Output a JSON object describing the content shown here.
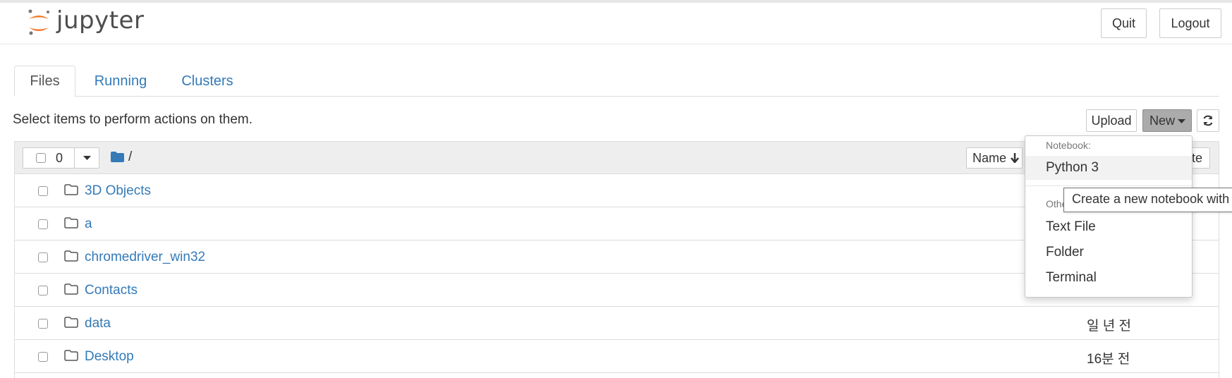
{
  "header": {
    "logo_text": "jupyter",
    "quit_label": "Quit",
    "logout_label": "Logout"
  },
  "tabs": [
    {
      "label": "Files",
      "active": true
    },
    {
      "label": "Running",
      "active": false
    },
    {
      "label": "Clusters",
      "active": false
    }
  ],
  "toolbar": {
    "info": "Select items to perform actions on them.",
    "upload_label": "Upload",
    "new_label": "New",
    "refresh_icon": "refresh-icon"
  },
  "list_header": {
    "selected_count": "0",
    "breadcrumb": "/",
    "sort_name_label": "Name",
    "partial_right_label": "te"
  },
  "files": [
    {
      "name": "3D Objects",
      "modified": ""
    },
    {
      "name": "a",
      "modified": ""
    },
    {
      "name": "chromedriver_win32",
      "modified": ""
    },
    {
      "name": "Contacts",
      "modified": ""
    },
    {
      "name": "data",
      "modified": "일 년 전"
    },
    {
      "name": "Desktop",
      "modified": "16분 전"
    }
  ],
  "new_menu": {
    "notebook_header": "Notebook:",
    "notebook_items": [
      "Python 3"
    ],
    "other_header": "Othe",
    "other_items": [
      "Text File",
      "Folder",
      "Terminal"
    ]
  },
  "tooltip": "Create a new notebook with",
  "colors": {
    "link": "#337ab7",
    "logo_orange": "#f37726",
    "logo_gray": "#767677",
    "header_bg": "#eeeeee"
  }
}
